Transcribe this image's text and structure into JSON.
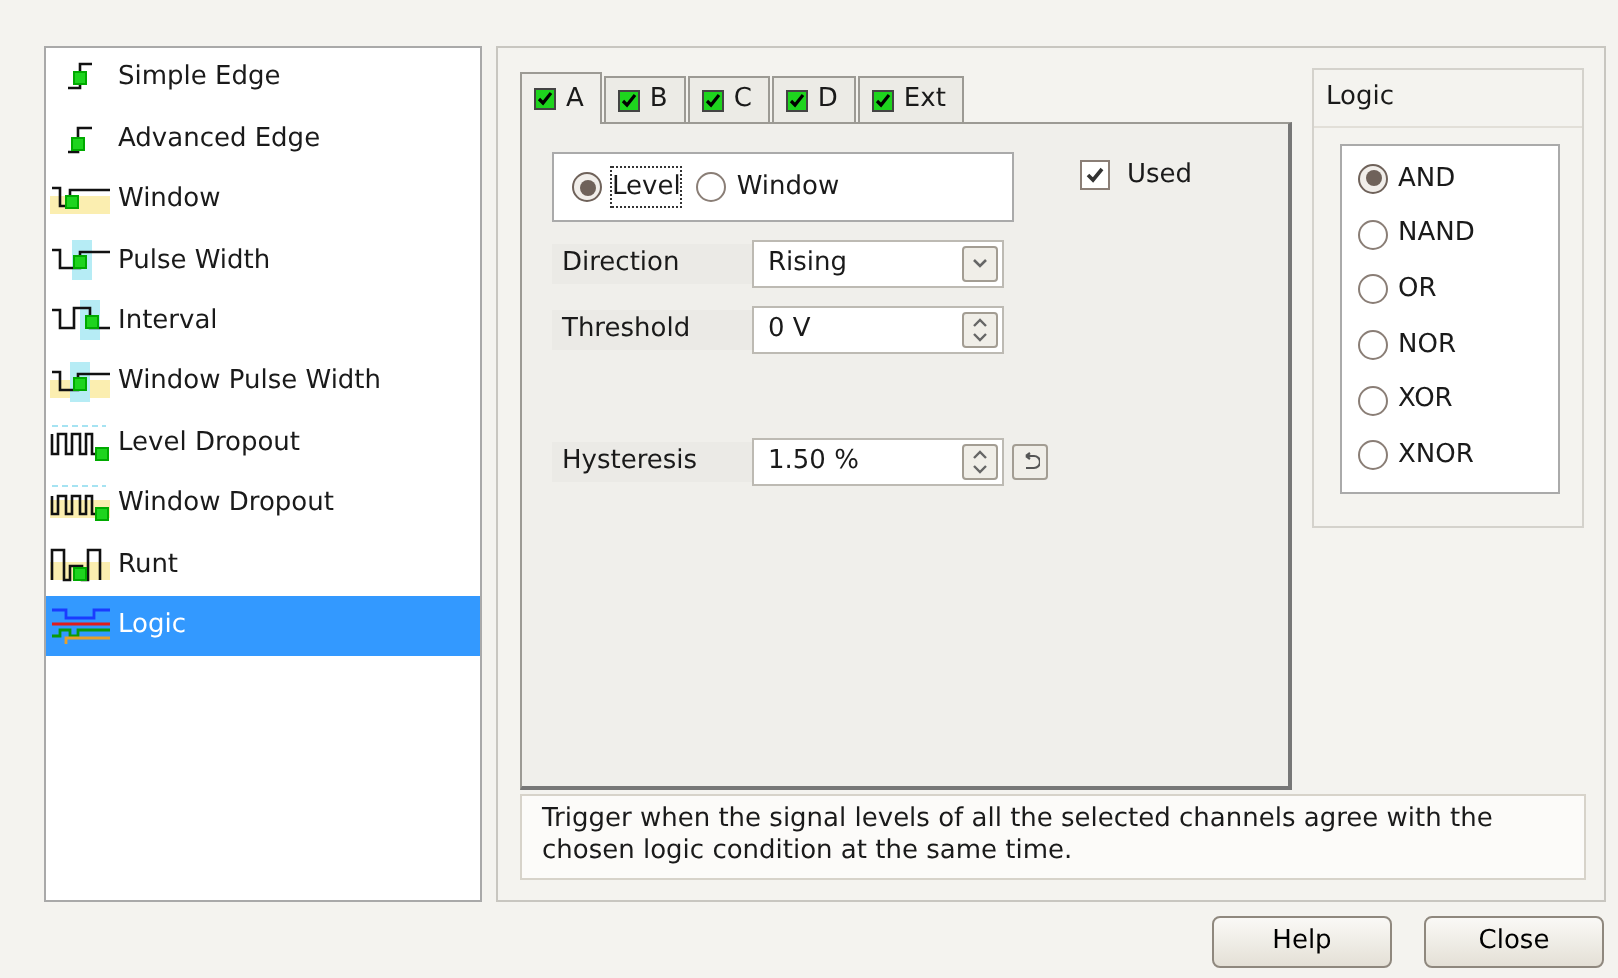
{
  "trigger_types": [
    {
      "label": "Simple Edge",
      "selected": false
    },
    {
      "label": "Advanced Edge",
      "selected": false
    },
    {
      "label": "Window",
      "selected": false
    },
    {
      "label": "Pulse Width",
      "selected": false
    },
    {
      "label": "Interval",
      "selected": false
    },
    {
      "label": "Window Pulse Width",
      "selected": false
    },
    {
      "label": "Level Dropout",
      "selected": false
    },
    {
      "label": "Window Dropout",
      "selected": false
    },
    {
      "label": "Runt",
      "selected": false
    },
    {
      "label": "Logic",
      "selected": true
    }
  ],
  "tabs": [
    {
      "label": "A",
      "checked": true,
      "selected": true
    },
    {
      "label": "B",
      "checked": true,
      "selected": false
    },
    {
      "label": "C",
      "checked": true,
      "selected": false
    },
    {
      "label": "D",
      "checked": true,
      "selected": false
    },
    {
      "label": "Ext",
      "checked": true,
      "selected": false
    }
  ],
  "mode": [
    {
      "label": "Level",
      "selected": true
    },
    {
      "label": "Window",
      "selected": false
    }
  ],
  "used": {
    "label": "Used",
    "checked": true
  },
  "fields": [
    {
      "kind": "dropdown",
      "label": "Direction",
      "value": "Rising"
    },
    {
      "kind": "spinner",
      "label": "Threshold",
      "value": "0 V"
    },
    {
      "kind": "spinner_reset",
      "label": "Hysteresis",
      "value": "1.50 %"
    }
  ],
  "logic": {
    "title": "Logic",
    "options": [
      {
        "label": "AND",
        "selected": true
      },
      {
        "label": "NAND",
        "selected": false
      },
      {
        "label": "OR",
        "selected": false
      },
      {
        "label": "NOR",
        "selected": false
      },
      {
        "label": "XOR",
        "selected": false
      },
      {
        "label": "XNOR",
        "selected": false
      }
    ]
  },
  "description": "Trigger when the signal levels of all the selected channels agree with the chosen logic condition at the same time.",
  "buttons": [
    {
      "label": "Help"
    },
    {
      "label": "Close"
    }
  ]
}
